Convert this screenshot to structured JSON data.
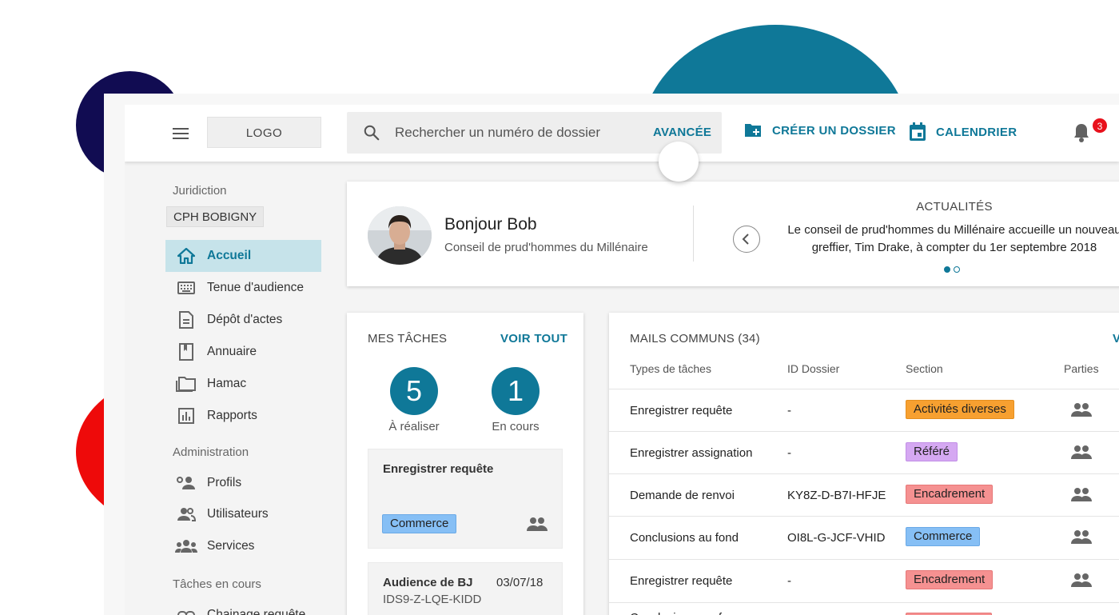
{
  "colors": {
    "accent": "#0f7898",
    "navy": "#110c52",
    "red": "#ee0a0a",
    "badge": "#e8111c"
  },
  "topbar": {
    "logo": "LOGO",
    "search_placeholder": "Rechercher un numéro de dossier",
    "advanced": "AVANCÉE",
    "create": "CRÉER UN DOSSIER",
    "calendar": "CALENDRIER",
    "notif_count": "3"
  },
  "sidebar": {
    "jurisdiction_label": "Juridiction",
    "jurisdiction": "CPH BOBIGNY",
    "main_items": [
      {
        "label": "Accueil",
        "icon": "home-icon"
      },
      {
        "label": "Tenue d'audience",
        "icon": "keyboard-icon"
      },
      {
        "label": "Dépôt d'actes",
        "icon": "document-icon"
      },
      {
        "label": "Annuaire",
        "icon": "book-icon"
      },
      {
        "label": "Hamac",
        "icon": "folder-icon"
      },
      {
        "label": "Rapports",
        "icon": "bar-chart-icon"
      }
    ],
    "admin_label": "Administration",
    "admin_items": [
      {
        "label": "Profils",
        "icon": "profile-settings-icon"
      },
      {
        "label": "Utilisateurs",
        "icon": "users-icon"
      },
      {
        "label": "Services",
        "icon": "groups-icon"
      }
    ],
    "tasks_label": "Tâches en cours",
    "tasks_items": [
      {
        "label": "Chainage requête"
      }
    ]
  },
  "welcome": {
    "greeting": "Bonjour Bob",
    "subtitle": "Conseil de prud'hommes du Millénaire",
    "news_title": "ACTUALITÉS",
    "news_line1": "Le conseil de prud'hommes du Millénaire accueille un nouveau",
    "news_line2": "greffier, Tim Drake, à compter du 1er septembre 2018"
  },
  "tasks": {
    "title": "MES TÂCHES",
    "see_all": "VOIR TOUT",
    "todo_count": "5",
    "todo_label": "À réaliser",
    "progress_count": "1",
    "progress_label": "En cours",
    "items": [
      {
        "name": "Enregistrer requête",
        "tag": "Commerce"
      },
      {
        "name": "Audience de BJ",
        "date": "03/07/18",
        "id": "IDS9-Z-LQE-KIDD"
      }
    ]
  },
  "mails": {
    "title": "MAILS COMMUNS (34)",
    "see_all": "V",
    "headers": {
      "type": "Types de tâches",
      "id": "ID Dossier",
      "section": "Section",
      "parties": "Parties"
    },
    "rows": [
      {
        "type": "Enregistrer requête",
        "id": "-",
        "section": "Activités diverses",
        "color": "orange"
      },
      {
        "type": "Enregistrer assignation",
        "id": "-",
        "section": "Référé",
        "color": "purple"
      },
      {
        "type": "Demande de renvoi",
        "id": "KY8Z-D-B7I-HFJE",
        "section": "Encadrement",
        "color": "red"
      },
      {
        "type": "Conclusions au fond",
        "id": "OI8L-G-JCF-VHID",
        "section": "Commerce",
        "color": "blue"
      },
      {
        "type": "Enregistrer requête",
        "id": "-",
        "section": "Encadrement",
        "color": "red"
      },
      {
        "type": "Conclusions sur fne",
        "id": "",
        "section": "",
        "color": "red"
      }
    ]
  }
}
